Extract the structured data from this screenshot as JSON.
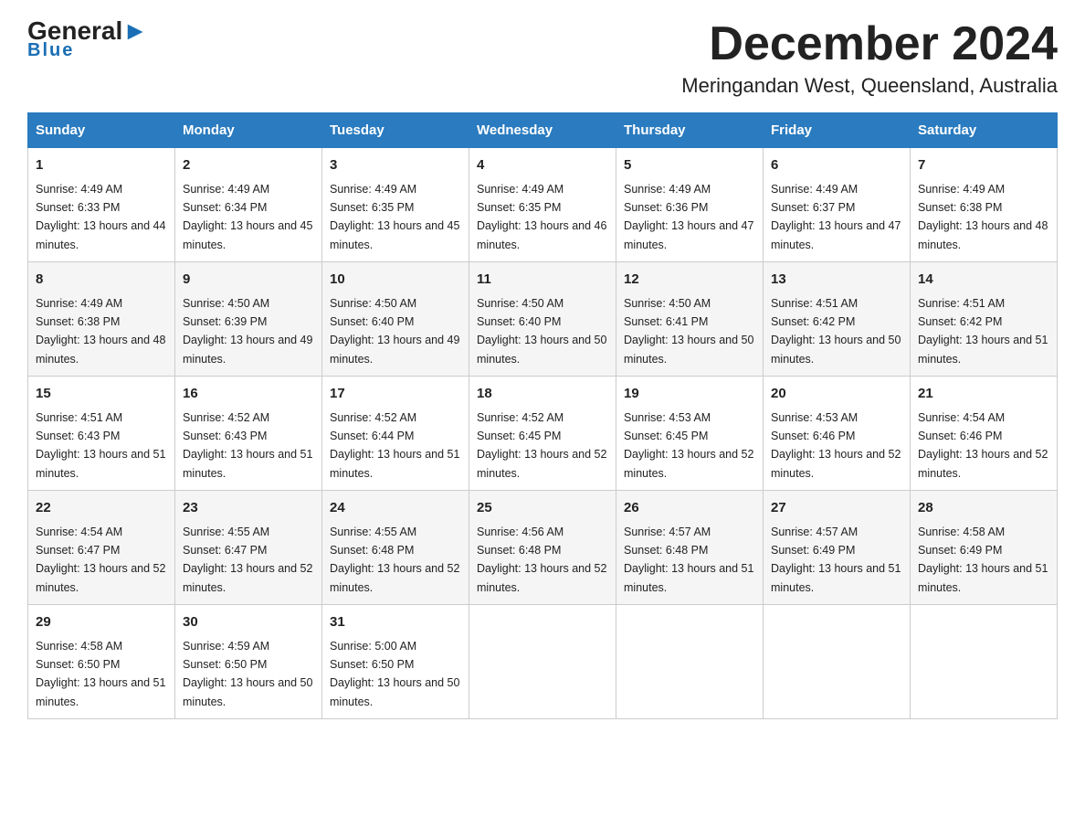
{
  "header": {
    "logo_general": "General",
    "logo_blue": "Blue",
    "title": "December 2024",
    "subtitle": "Meringandan West, Queensland, Australia"
  },
  "days_of_week": [
    "Sunday",
    "Monday",
    "Tuesday",
    "Wednesday",
    "Thursday",
    "Friday",
    "Saturday"
  ],
  "weeks": [
    [
      {
        "day": "1",
        "sunrise": "4:49 AM",
        "sunset": "6:33 PM",
        "daylight": "13 hours and 44 minutes."
      },
      {
        "day": "2",
        "sunrise": "4:49 AM",
        "sunset": "6:34 PM",
        "daylight": "13 hours and 45 minutes."
      },
      {
        "day": "3",
        "sunrise": "4:49 AM",
        "sunset": "6:35 PM",
        "daylight": "13 hours and 45 minutes."
      },
      {
        "day": "4",
        "sunrise": "4:49 AM",
        "sunset": "6:35 PM",
        "daylight": "13 hours and 46 minutes."
      },
      {
        "day": "5",
        "sunrise": "4:49 AM",
        "sunset": "6:36 PM",
        "daylight": "13 hours and 47 minutes."
      },
      {
        "day": "6",
        "sunrise": "4:49 AM",
        "sunset": "6:37 PM",
        "daylight": "13 hours and 47 minutes."
      },
      {
        "day": "7",
        "sunrise": "4:49 AM",
        "sunset": "6:38 PM",
        "daylight": "13 hours and 48 minutes."
      }
    ],
    [
      {
        "day": "8",
        "sunrise": "4:49 AM",
        "sunset": "6:38 PM",
        "daylight": "13 hours and 48 minutes."
      },
      {
        "day": "9",
        "sunrise": "4:50 AM",
        "sunset": "6:39 PM",
        "daylight": "13 hours and 49 minutes."
      },
      {
        "day": "10",
        "sunrise": "4:50 AM",
        "sunset": "6:40 PM",
        "daylight": "13 hours and 49 minutes."
      },
      {
        "day": "11",
        "sunrise": "4:50 AM",
        "sunset": "6:40 PM",
        "daylight": "13 hours and 50 minutes."
      },
      {
        "day": "12",
        "sunrise": "4:50 AM",
        "sunset": "6:41 PM",
        "daylight": "13 hours and 50 minutes."
      },
      {
        "day": "13",
        "sunrise": "4:51 AM",
        "sunset": "6:42 PM",
        "daylight": "13 hours and 50 minutes."
      },
      {
        "day": "14",
        "sunrise": "4:51 AM",
        "sunset": "6:42 PM",
        "daylight": "13 hours and 51 minutes."
      }
    ],
    [
      {
        "day": "15",
        "sunrise": "4:51 AM",
        "sunset": "6:43 PM",
        "daylight": "13 hours and 51 minutes."
      },
      {
        "day": "16",
        "sunrise": "4:52 AM",
        "sunset": "6:43 PM",
        "daylight": "13 hours and 51 minutes."
      },
      {
        "day": "17",
        "sunrise": "4:52 AM",
        "sunset": "6:44 PM",
        "daylight": "13 hours and 51 minutes."
      },
      {
        "day": "18",
        "sunrise": "4:52 AM",
        "sunset": "6:45 PM",
        "daylight": "13 hours and 52 minutes."
      },
      {
        "day": "19",
        "sunrise": "4:53 AM",
        "sunset": "6:45 PM",
        "daylight": "13 hours and 52 minutes."
      },
      {
        "day": "20",
        "sunrise": "4:53 AM",
        "sunset": "6:46 PM",
        "daylight": "13 hours and 52 minutes."
      },
      {
        "day": "21",
        "sunrise": "4:54 AM",
        "sunset": "6:46 PM",
        "daylight": "13 hours and 52 minutes."
      }
    ],
    [
      {
        "day": "22",
        "sunrise": "4:54 AM",
        "sunset": "6:47 PM",
        "daylight": "13 hours and 52 minutes."
      },
      {
        "day": "23",
        "sunrise": "4:55 AM",
        "sunset": "6:47 PM",
        "daylight": "13 hours and 52 minutes."
      },
      {
        "day": "24",
        "sunrise": "4:55 AM",
        "sunset": "6:48 PM",
        "daylight": "13 hours and 52 minutes."
      },
      {
        "day": "25",
        "sunrise": "4:56 AM",
        "sunset": "6:48 PM",
        "daylight": "13 hours and 52 minutes."
      },
      {
        "day": "26",
        "sunrise": "4:57 AM",
        "sunset": "6:48 PM",
        "daylight": "13 hours and 51 minutes."
      },
      {
        "day": "27",
        "sunrise": "4:57 AM",
        "sunset": "6:49 PM",
        "daylight": "13 hours and 51 minutes."
      },
      {
        "day": "28",
        "sunrise": "4:58 AM",
        "sunset": "6:49 PM",
        "daylight": "13 hours and 51 minutes."
      }
    ],
    [
      {
        "day": "29",
        "sunrise": "4:58 AM",
        "sunset": "6:50 PM",
        "daylight": "13 hours and 51 minutes."
      },
      {
        "day": "30",
        "sunrise": "4:59 AM",
        "sunset": "6:50 PM",
        "daylight": "13 hours and 50 minutes."
      },
      {
        "day": "31",
        "sunrise": "5:00 AM",
        "sunset": "6:50 PM",
        "daylight": "13 hours and 50 minutes."
      },
      null,
      null,
      null,
      null
    ]
  ]
}
